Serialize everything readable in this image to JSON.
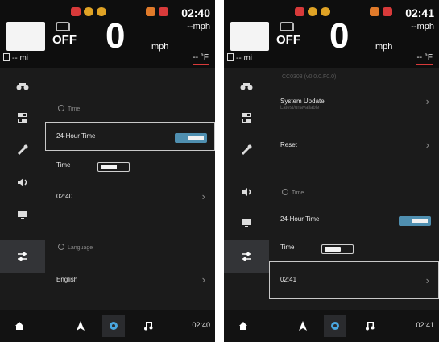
{
  "colors": {
    "accent": "#4f8fb0",
    "warning_red": "#d83a3a",
    "warning_orange": "#e07a2a",
    "bg": "#1b1b1b"
  },
  "left": {
    "clock": "02:40",
    "speed_unit_top": "--mph",
    "gear": "OFF",
    "speed": "0",
    "speed_unit": "mph",
    "range": "-- mi",
    "temperature": "-- °F",
    "sections": {
      "time_header": "Time",
      "language_header": "Language"
    },
    "rows": {
      "hour24_label": "24-Hour Time",
      "time_label": "Time",
      "time_value": "02:40",
      "language_value": "English"
    },
    "toggles": {
      "hour24": "on",
      "time": "off"
    },
    "bottom_clock": "02:40"
  },
  "right": {
    "clock": "02:41",
    "speed_unit_top": "--mph",
    "gear": "OFF",
    "speed": "0",
    "speed_unit": "mph",
    "range": "-- mi",
    "temperature": "-- °F",
    "faded_header": "CC0303 (v0.0.0.F0.0)",
    "rows": {
      "system_update_label": "System Update",
      "system_update_sub": "Latest/unavailable",
      "reset_label": "Reset",
      "time_header": "Time",
      "hour24_label": "24-Hour Time",
      "time_label": "Time",
      "time_value": "02:41"
    },
    "toggles": {
      "hour24": "on",
      "time": "off"
    },
    "bottom_clock": "02:41"
  },
  "icons": {
    "sidenav": [
      "motorcycle-icon",
      "switches-icon",
      "tools-icon",
      "volume-icon",
      "display-icon",
      "settings-sliders-icon"
    ],
    "bottom": [
      "home-icon",
      "navigation-icon",
      "settings-gear-icon",
      "music-icon"
    ]
  }
}
